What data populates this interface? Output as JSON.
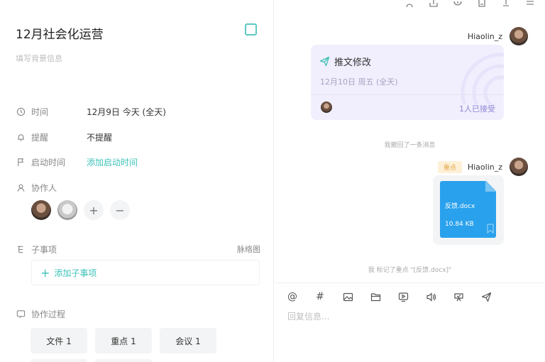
{
  "task": {
    "title": "12月社会化运营",
    "background_placeholder": "填写背景信息",
    "fields": {
      "time": {
        "label": "时间",
        "value": "12月9日 今天 (全天)"
      },
      "reminder": {
        "label": "提醒",
        "value": "不提醒"
      },
      "start_time": {
        "label": "启动时间",
        "value": "添加启动时间"
      },
      "collaborators": {
        "label": "协作人"
      }
    },
    "subtasks": {
      "label": "子事项",
      "mindmap_link": "脉络图",
      "add_label": "添加子事项"
    },
    "process": {
      "label": "协作过程",
      "tags": [
        "文件 1",
        "重点 1",
        "会议 1"
      ]
    }
  },
  "chat": {
    "messages": [
      {
        "sender": "Hiaolin_z",
        "type": "event",
        "event_title": "推文修改",
        "event_date": "12月10日 周五 (全天)",
        "accepted": "1人已接受"
      },
      {
        "type": "system",
        "text": "我撤回了一条消息"
      },
      {
        "sender": "Hiaolin_z",
        "badge": "重点",
        "type": "file",
        "file_name": "反馈.docx",
        "file_size": "10.84 KB"
      },
      {
        "type": "system",
        "text": "我 标记了重点 \"[反馈.docx]\""
      }
    ],
    "composer": {
      "placeholder": "回复信息...",
      "tools": [
        "at-icon",
        "hashtag-icon",
        "image-icon",
        "folder-icon",
        "video-icon",
        "audio-icon",
        "cloud-icon",
        "send-icon"
      ]
    }
  },
  "colors": {
    "accent": "#3ec2b8",
    "event_bg": "#f1effd",
    "file_blue": "#2aa1ec",
    "badge_bg": "#fdf0d7"
  }
}
